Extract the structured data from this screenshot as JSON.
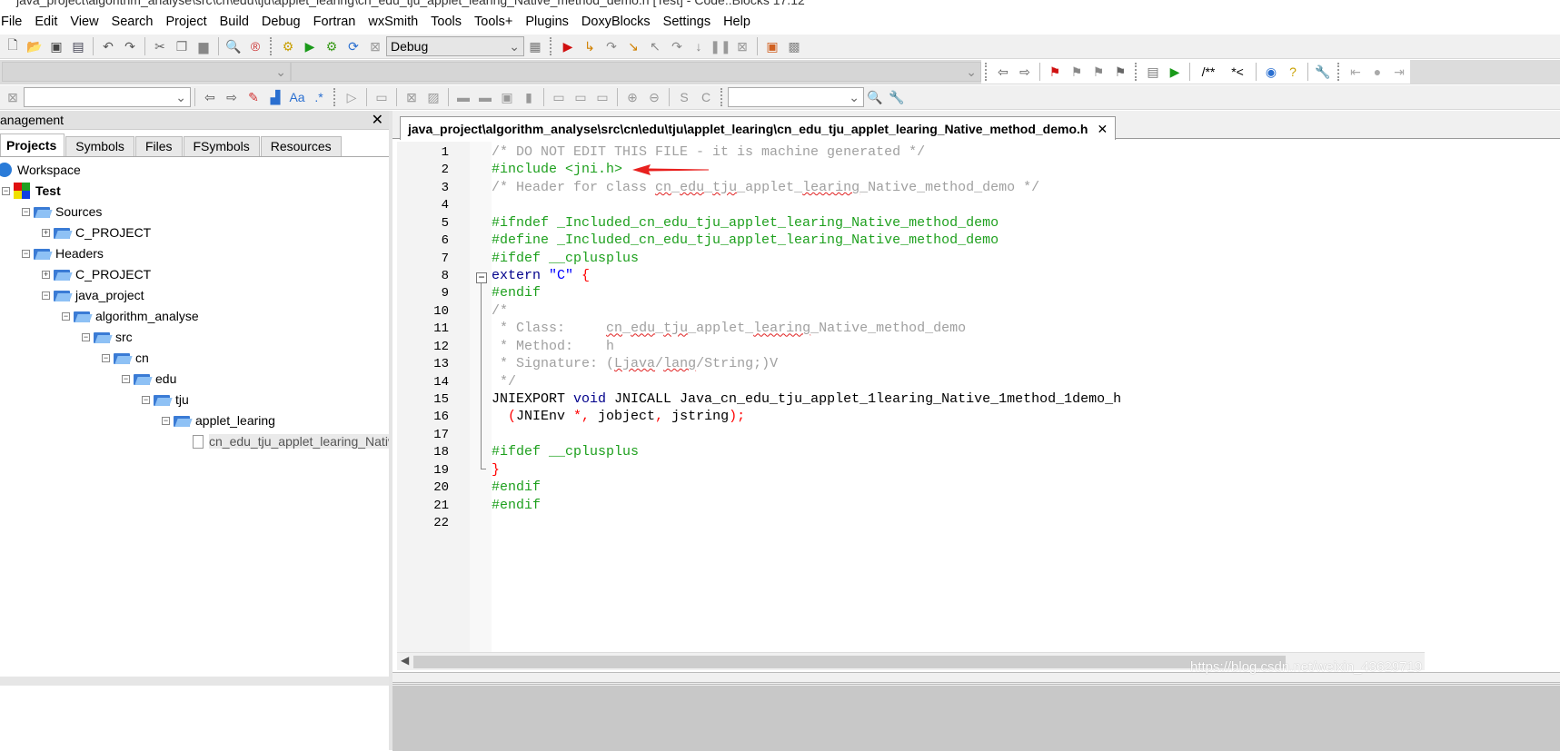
{
  "window": {
    "title": "java_project\\algorithm_analyse\\src\\cn\\edu\\tju\\applet_learing\\cn_edu_tju_applet_learing_Native_method_demo.h [Test] - Code::Blocks 17.12"
  },
  "menu": [
    "File",
    "Edit",
    "View",
    "Search",
    "Project",
    "Build",
    "Debug",
    "Fortran",
    "wxSmith",
    "Tools",
    "Tools+",
    "Plugins",
    "DoxyBlocks",
    "Settings",
    "Help"
  ],
  "toolbar1": {
    "icons": [
      "new-file-icon",
      "open-icon",
      "save-icon",
      "save-all-icon",
      "undo-icon",
      "redo-icon",
      "cut-icon",
      "copy-icon",
      "paste-icon",
      "find-icon",
      "replace-icon",
      "build-icon",
      "run-icon",
      "build-run-icon",
      "rebuild-icon",
      "abort-icon"
    ],
    "build_target": "Debug",
    "debug_icons": [
      "target-options-icon",
      "debug-start-icon",
      "run-to-cursor-icon",
      "next-line-icon",
      "step-into-icon",
      "step-out-icon",
      "next-instruction-icon",
      "step-instruction-icon",
      "break-icon",
      "stop-debug-icon",
      "debug-windows-icon",
      "info-icon"
    ]
  },
  "toolbar2": {
    "right_icons": [
      "back-icon",
      "forward-icon",
      "toggle-bookmark-icon",
      "prev-bookmark-icon",
      "next-bookmark-icon",
      "clear-bookmarks-icon",
      "doxywizard-icon",
      "extract-docs-icon",
      "block-comment-icon",
      "line-comment-icon",
      "chm-icon",
      "help-icon",
      "config-icon",
      "prev-icon",
      "record-icon",
      "next-icon"
    ],
    "block_comment": "/**",
    "line_comment": "*<"
  },
  "toolbar3": {
    "search_value": "",
    "icons": [
      "jump-back-icon",
      "jump-forward-icon",
      "highlight-icon",
      "browse-icon",
      "match-case-icon",
      "regex-icon"
    ]
  },
  "management": {
    "title": "anagement",
    "tabs": [
      "Projects",
      "Symbols",
      "Files",
      "FSymbols",
      "Resources"
    ],
    "active_tab": "Projects",
    "tree": [
      {
        "label": "Workspace",
        "depth": 0,
        "type": "workspace"
      },
      {
        "label": "Test",
        "depth": 1,
        "type": "project",
        "toggle": "-"
      },
      {
        "label": "Sources",
        "depth": 2,
        "type": "folder",
        "toggle": "-"
      },
      {
        "label": "C_PROJECT",
        "depth": 3,
        "type": "folder",
        "toggle": "+"
      },
      {
        "label": "Headers",
        "depth": 2,
        "type": "folder",
        "toggle": "-"
      },
      {
        "label": "C_PROJECT",
        "depth": 3,
        "type": "folder",
        "toggle": "+"
      },
      {
        "label": "java_project",
        "depth": 3,
        "type": "folder",
        "toggle": "-"
      },
      {
        "label": "algorithm_analyse",
        "depth": 4,
        "type": "folder",
        "toggle": "-"
      },
      {
        "label": "src",
        "depth": 5,
        "type": "folder",
        "toggle": "-"
      },
      {
        "label": "cn",
        "depth": 6,
        "type": "folder",
        "toggle": "-"
      },
      {
        "label": "edu",
        "depth": 7,
        "type": "folder",
        "toggle": "-"
      },
      {
        "label": "tju",
        "depth": 8,
        "type": "folder",
        "toggle": "-"
      },
      {
        "label": "applet_learing",
        "depth": 9,
        "type": "folder",
        "toggle": "-"
      },
      {
        "label": "cn_edu_tju_applet_learing_Native_method_demo.h",
        "depth": 10,
        "type": "file",
        "selected": true
      }
    ]
  },
  "editor": {
    "tab_label": "java_project\\algorithm_analyse\\src\\cn\\edu\\tju\\applet_learing\\cn_edu_tju_applet_learing_Native_method_demo.h",
    "lines": [
      [
        [
          "cm",
          "/* DO NOT EDIT THIS FILE - it is machine generated */"
        ]
      ],
      [
        [
          "pp",
          "#include <jni.h>"
        ]
      ],
      [
        [
          "cm",
          "/* Header for class "
        ],
        [
          "cm w",
          "cn"
        ],
        [
          "cm",
          "_"
        ],
        [
          "cm w",
          "edu"
        ],
        [
          "cm",
          "_"
        ],
        [
          "cm w",
          "tju"
        ],
        [
          "cm",
          "_applet_"
        ],
        [
          "cm w",
          "learing"
        ],
        [
          "cm",
          "_Native_method_demo */"
        ]
      ],
      [],
      [
        [
          "pp",
          "#ifndef _Included_cn_edu_tju_applet_learing_Native_method_demo"
        ]
      ],
      [
        [
          "pp",
          "#define _Included_cn_edu_tju_applet_learing_Native_method_demo"
        ]
      ],
      [
        [
          "pp",
          "#ifdef __cplusplus"
        ]
      ],
      [
        [
          "kw",
          "extern "
        ],
        [
          "st",
          "\"C\""
        ],
        [
          "op",
          " {"
        ]
      ],
      [
        [
          "pp",
          "#endif"
        ]
      ],
      [
        [
          "cm",
          "/*"
        ]
      ],
      [
        [
          "cm",
          " * Class:     "
        ],
        [
          "cm w",
          "cn"
        ],
        [
          "cm",
          "_"
        ],
        [
          "cm w",
          "edu"
        ],
        [
          "cm",
          "_"
        ],
        [
          "cm w",
          "tju"
        ],
        [
          "cm",
          "_applet_"
        ],
        [
          "cm w",
          "learing"
        ],
        [
          "cm",
          "_Native_method_demo"
        ]
      ],
      [
        [
          "cm",
          " * Method:    h"
        ]
      ],
      [
        [
          "cm",
          " * Signature: ("
        ],
        [
          "cm w",
          "Ljava"
        ],
        [
          "cm",
          "/"
        ],
        [
          "cm w",
          "lang"
        ],
        [
          "cm",
          "/String;)V"
        ]
      ],
      [
        [
          "cm",
          " */"
        ]
      ],
      [
        [
          "tx",
          "JNIEXPORT "
        ],
        [
          "kw",
          "void"
        ],
        [
          "tx",
          " JNICALL Java_cn_edu_tju_applet_1learing_Native_1method_1demo_h"
        ]
      ],
      [
        [
          "op",
          "  ("
        ],
        [
          "tx",
          "JNIEnv "
        ],
        [
          "op",
          "*,"
        ],
        [
          "tx",
          " jobject"
        ],
        [
          "op",
          ","
        ],
        [
          "tx",
          " jstring"
        ],
        [
          "op",
          ");"
        ]
      ],
      [],
      [
        [
          "pp",
          "#ifdef __cplusplus"
        ]
      ],
      [
        [
          "op",
          "}"
        ]
      ],
      [
        [
          "pp",
          "#endif"
        ]
      ],
      [
        [
          "pp",
          "#endif"
        ]
      ],
      []
    ]
  },
  "annotation": {
    "type": "red-arrow",
    "points_to_line": 2,
    "color": "#e8201e"
  },
  "watermark": "https://blog.csdn.net/weixin_43629719",
  "colors": {
    "comment": "#a0a0a0",
    "preprocessor": "#1ea01e",
    "keyword": "#00008b",
    "string": "#0000ff",
    "operator": "#ff0000"
  }
}
